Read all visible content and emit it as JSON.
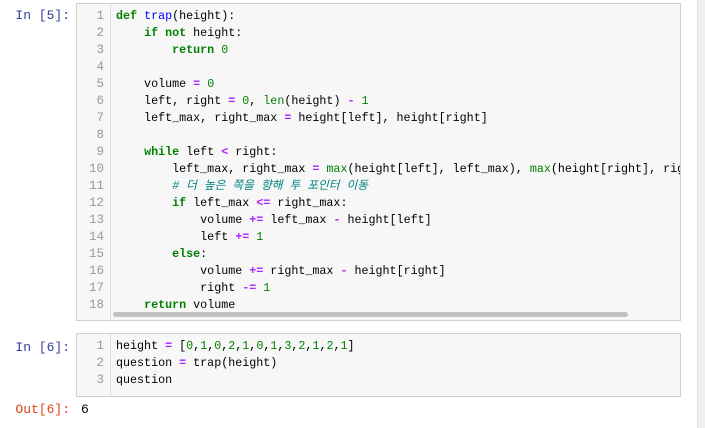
{
  "cells": [
    {
      "prompt": "In [5]:",
      "lines": [
        [
          [
            "def",
            "kw"
          ],
          [
            " ",
            ""
          ],
          [
            "trap",
            "fn"
          ],
          [
            "(height):",
            ""
          ]
        ],
        [
          [
            "    ",
            ""
          ],
          [
            "if not",
            "kw"
          ],
          [
            " height:",
            ""
          ]
        ],
        [
          [
            "        ",
            ""
          ],
          [
            "return",
            "kw"
          ],
          [
            " ",
            ""
          ],
          [
            "0",
            "num"
          ]
        ],
        [],
        [
          [
            "    volume ",
            ""
          ],
          [
            "=",
            "op"
          ],
          [
            " ",
            ""
          ],
          [
            "0",
            "num"
          ]
        ],
        [
          [
            "    left, right ",
            ""
          ],
          [
            "=",
            "op"
          ],
          [
            " ",
            ""
          ],
          [
            "0",
            "num"
          ],
          [
            ", ",
            ""
          ],
          [
            "len",
            "bi"
          ],
          [
            "(height) ",
            ""
          ],
          [
            "-",
            "op"
          ],
          [
            " ",
            ""
          ],
          [
            "1",
            "num"
          ]
        ],
        [
          [
            "    left_max, right_max ",
            ""
          ],
          [
            "=",
            "op"
          ],
          [
            " height[left], height[right]",
            ""
          ]
        ],
        [],
        [
          [
            "    ",
            ""
          ],
          [
            "while",
            "kw"
          ],
          [
            " left ",
            ""
          ],
          [
            "<",
            "op"
          ],
          [
            " right:",
            ""
          ]
        ],
        [
          [
            "        left_max, right_max ",
            ""
          ],
          [
            "=",
            "op"
          ],
          [
            " ",
            ""
          ],
          [
            "max",
            "bi"
          ],
          [
            "(height[left], left_max), ",
            ""
          ],
          [
            "max",
            "bi"
          ],
          [
            "(height[right], rig",
            ""
          ]
        ],
        [
          [
            "        ",
            ""
          ],
          [
            "# 더 높은 쪽을 향해 투 포인터 이동",
            "cm"
          ]
        ],
        [
          [
            "        ",
            ""
          ],
          [
            "if",
            "kw"
          ],
          [
            " left_max ",
            ""
          ],
          [
            "<=",
            "op"
          ],
          [
            " right_max:",
            ""
          ]
        ],
        [
          [
            "            volume ",
            ""
          ],
          [
            "+=",
            "op"
          ],
          [
            " left_max ",
            ""
          ],
          [
            "-",
            "op"
          ],
          [
            " height[left]",
            ""
          ]
        ],
        [
          [
            "            left ",
            ""
          ],
          [
            "+=",
            "op"
          ],
          [
            " ",
            ""
          ],
          [
            "1",
            "num"
          ]
        ],
        [
          [
            "        ",
            ""
          ],
          [
            "else",
            "kw"
          ],
          [
            ":",
            ""
          ]
        ],
        [
          [
            "            volume ",
            ""
          ],
          [
            "+=",
            "op"
          ],
          [
            " right_max ",
            ""
          ],
          [
            "-",
            "op"
          ],
          [
            " height[right]",
            ""
          ]
        ],
        [
          [
            "            right ",
            ""
          ],
          [
            "-=",
            "op"
          ],
          [
            " ",
            ""
          ],
          [
            "1",
            "num"
          ]
        ],
        [
          [
            "    ",
            ""
          ],
          [
            "return",
            "kw"
          ],
          [
            " volume",
            ""
          ]
        ]
      ]
    },
    {
      "prompt": "In [6]:",
      "lines": [
        [
          [
            "height ",
            ""
          ],
          [
            "=",
            "op"
          ],
          [
            " [",
            ""
          ],
          [
            "0",
            "num"
          ],
          [
            ",",
            ""
          ],
          [
            "1",
            "num"
          ],
          [
            ",",
            ""
          ],
          [
            "0",
            "num"
          ],
          [
            ",",
            ""
          ],
          [
            "2",
            "num"
          ],
          [
            ",",
            ""
          ],
          [
            "1",
            "num"
          ],
          [
            ",",
            ""
          ],
          [
            "0",
            "num"
          ],
          [
            ",",
            ""
          ],
          [
            "1",
            "num"
          ],
          [
            ",",
            ""
          ],
          [
            "3",
            "num"
          ],
          [
            ",",
            ""
          ],
          [
            "2",
            "num"
          ],
          [
            ",",
            ""
          ],
          [
            "1",
            "num"
          ],
          [
            ",",
            ""
          ],
          [
            "2",
            "num"
          ],
          [
            ",",
            ""
          ],
          [
            "1",
            "num"
          ],
          [
            "]",
            ""
          ]
        ],
        [
          [
            "question ",
            ""
          ],
          [
            "=",
            "op"
          ],
          [
            " trap(height)",
            ""
          ]
        ],
        [
          [
            "question",
            ""
          ]
        ]
      ],
      "output_prompt": "Out[6]:",
      "output": "6"
    }
  ],
  "colors": {
    "in_prompt": "#303f9f",
    "out_prompt": "#d84315",
    "keyword": "#008000",
    "operator": "#aa22ff",
    "comment": "#008080",
    "function": "#0000ff"
  }
}
